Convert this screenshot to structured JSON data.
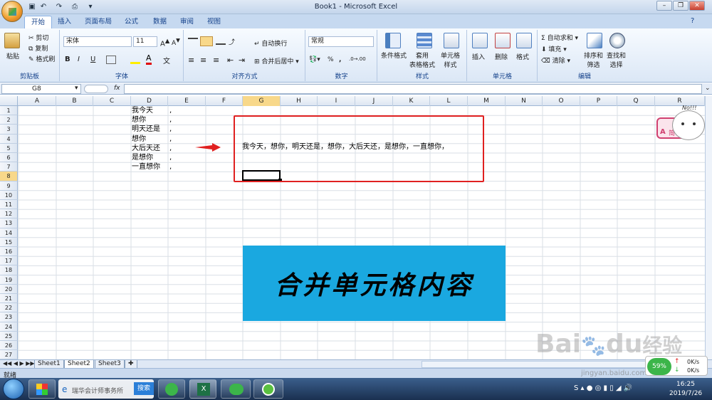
{
  "window": {
    "title": "Book1 - Microsoft Excel"
  },
  "tabs": [
    "开始",
    "插入",
    "页面布局",
    "公式",
    "数据",
    "审阅",
    "视图"
  ],
  "ribbon": {
    "clipboard": {
      "paste": "粘贴",
      "cut": "剪切",
      "copy": "复制",
      "format_painter": "格式刷",
      "label": "剪贴板"
    },
    "font": {
      "name": "宋体",
      "size": "11",
      "bold": "B",
      "italic": "I",
      "underline": "U",
      "label": "字体"
    },
    "alignment": {
      "wrap": "自动换行",
      "merge": "合并后居中",
      "label": "对齐方式"
    },
    "number": {
      "format": "常规",
      "percent": "%",
      "comma": ",",
      "label": "数字"
    },
    "styles": {
      "cond": "条件格式",
      "table": "套用\n表格格式",
      "cell": "单元格\n样式",
      "label": "样式"
    },
    "cells": {
      "insert": "插入",
      "delete": "删除",
      "format": "格式",
      "label": "单元格"
    },
    "editing": {
      "autosum": "自动求和",
      "fill": "填充",
      "clear": "清除",
      "sort": "排序和\n筛选",
      "find": "查找和\n选择",
      "label": "编辑"
    }
  },
  "formula_bar": {
    "name_box": "G8",
    "fx": "fx"
  },
  "columns": [
    "A",
    "B",
    "C",
    "D",
    "E",
    "F",
    "G",
    "H",
    "I",
    "J",
    "K",
    "L",
    "M",
    "N",
    "O",
    "P",
    "Q",
    "R"
  ],
  "rows": [
    "1",
    "2",
    "3",
    "4",
    "5",
    "6",
    "7",
    "8",
    "9",
    "10",
    "11",
    "12",
    "13",
    "14",
    "15",
    "16",
    "17",
    "18",
    "19",
    "20",
    "21",
    "22",
    "23",
    "24",
    "25",
    "26",
    "27"
  ],
  "cells_d": [
    "我今天",
    "想你",
    "明天还是",
    "想你",
    "大后天还",
    "是想你",
    "一直想你"
  ],
  "cells_e": [
    ",",
    ",",
    ",",
    ",",
    ",",
    ",",
    ","
  ],
  "merged_text": "我今天，想你，明天还是，想你，大后天还，是想你，一直想你，",
  "banner": "合并单元格内容",
  "sticker": {
    "no": "No!!!",
    "letter": "A",
    "han": "简"
  },
  "sheets": [
    "Sheet1",
    "Sheet2",
    "Sheet3"
  ],
  "status": {
    "ready": "就绪"
  },
  "taskbar": {
    "ie_tab": "瑞华会计师事务所",
    "search": "搜索",
    "time": "16:25",
    "date": "2019/7/26",
    "net_up": "0K/s",
    "net_down": "0K/s",
    "cpu": "59%"
  },
  "watermark": {
    "brand": "Bai",
    "du": "du",
    "jy": "经验",
    "url": "jingyan.baidu.com"
  },
  "colors": {
    "red_box": "#e02020",
    "banner_bg": "#1aa8e0",
    "arrow": "#e02020"
  }
}
